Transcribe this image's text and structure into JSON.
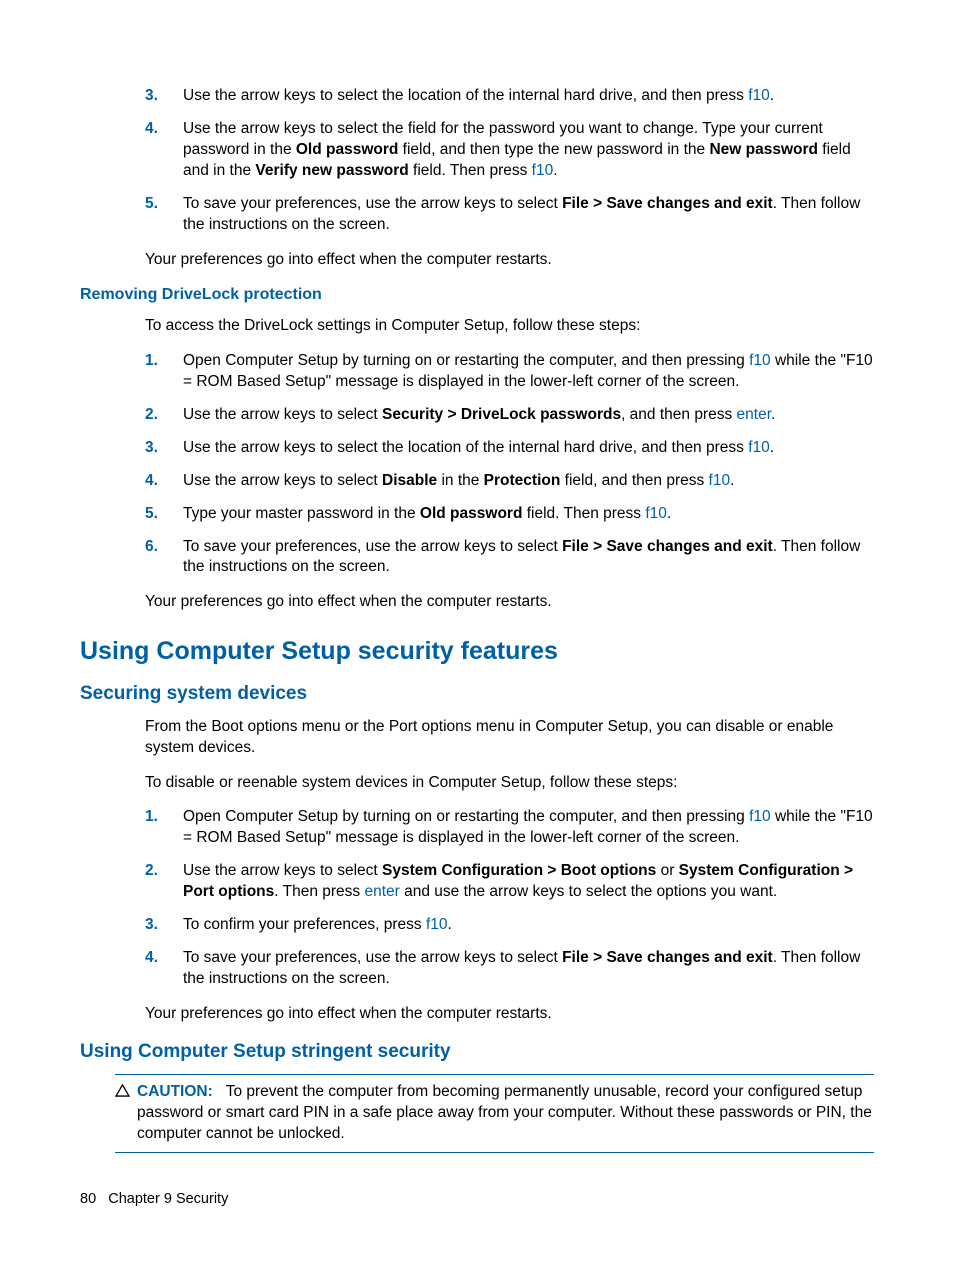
{
  "list1": {
    "items": [
      {
        "num": "3.",
        "t1": "Use the arrow keys to select the location of the internal hard drive, and then press ",
        "k1": "f10",
        "t2": "."
      },
      {
        "num": "4.",
        "t1": "Use the arrow keys to select the field for the password you want to change. Type your current password in the ",
        "b1": "Old password",
        "t2": " field, and then type the new password in the ",
        "b2": "New password",
        "t3": " field and in the ",
        "b3": "Verify new password",
        "t4": " field. Then press ",
        "k1": "f10",
        "t5": "."
      },
      {
        "num": "5.",
        "t1": "To save your preferences, use the arrow keys to select ",
        "b1": "File > Save changes and exit",
        "t2": ". Then follow the instructions on the screen."
      }
    ],
    "after": "Your preferences go into effect when the computer restarts."
  },
  "sec_removing": {
    "heading": "Removing DriveLock protection",
    "intro": "To access the DriveLock settings in Computer Setup, follow these steps:",
    "items": [
      {
        "num": "1.",
        "t1": "Open Computer Setup by turning on or restarting the computer, and then pressing ",
        "k1": "f10",
        "t2": " while the \"F10 = ROM Based Setup\" message is displayed in the lower-left corner of the screen."
      },
      {
        "num": "2.",
        "t1": "Use the arrow keys to select ",
        "b1": "Security > DriveLock passwords",
        "t2": ", and then press ",
        "k1": "enter",
        "t3": "."
      },
      {
        "num": "3.",
        "t1": "Use the arrow keys to select the location of the internal hard drive, and then press ",
        "k1": "f10",
        "t2": "."
      },
      {
        "num": "4.",
        "t1": "Use the arrow keys to select ",
        "b1": "Disable",
        "t2": " in the ",
        "b2": "Protection",
        "t3": " field, and then press ",
        "k1": "f10",
        "t4": "."
      },
      {
        "num": "5.",
        "t1": "Type your master password in the ",
        "b1": "Old password",
        "t2": " field. Then press ",
        "k1": "f10",
        "t3": "."
      },
      {
        "num": "6.",
        "t1": "To save your preferences, use the arrow keys to select ",
        "b1": "File > Save changes and exit",
        "t2": ". Then follow the instructions on the screen."
      }
    ],
    "after": "Your preferences go into effect when the computer restarts."
  },
  "sec_main": {
    "heading": "Using Computer Setup security features"
  },
  "sec_securing": {
    "heading": "Securing system devices",
    "intro1": "From the Boot options menu or the Port options menu in Computer Setup, you can disable or enable system devices.",
    "intro2": "To disable or reenable system devices in Computer Setup, follow these steps:",
    "items": [
      {
        "num": "1.",
        "t1": "Open Computer Setup by turning on or restarting the computer, and then pressing ",
        "k1": "f10",
        "t2": " while the \"F10 = ROM Based Setup\" message is displayed in the lower-left corner of the screen."
      },
      {
        "num": "2.",
        "t1": "Use the arrow keys to select ",
        "b1": "System Configuration > Boot options",
        "t2": " or ",
        "b2": "System Configuration > Port options",
        "t3": ". Then press ",
        "k1": "enter",
        "t4": " and use the arrow keys to select the options you want."
      },
      {
        "num": "3.",
        "t1": "To confirm your preferences, press ",
        "k1": "f10",
        "t2": "."
      },
      {
        "num": "4.",
        "t1": "To save your preferences, use the arrow keys to select ",
        "b1": "File > Save changes and exit",
        "t2": ". Then follow the instructions on the screen."
      }
    ],
    "after": "Your preferences go into effect when the computer restarts."
  },
  "sec_stringent": {
    "heading": "Using Computer Setup stringent security",
    "caution_label": "CAUTION:",
    "caution_text": "To prevent the computer from becoming permanently unusable, record your configured setup password or smart card PIN in a safe place away from your computer. Without these passwords or PIN, the computer cannot be unlocked."
  },
  "footer": {
    "page": "80",
    "chapter": "Chapter 9   Security"
  }
}
